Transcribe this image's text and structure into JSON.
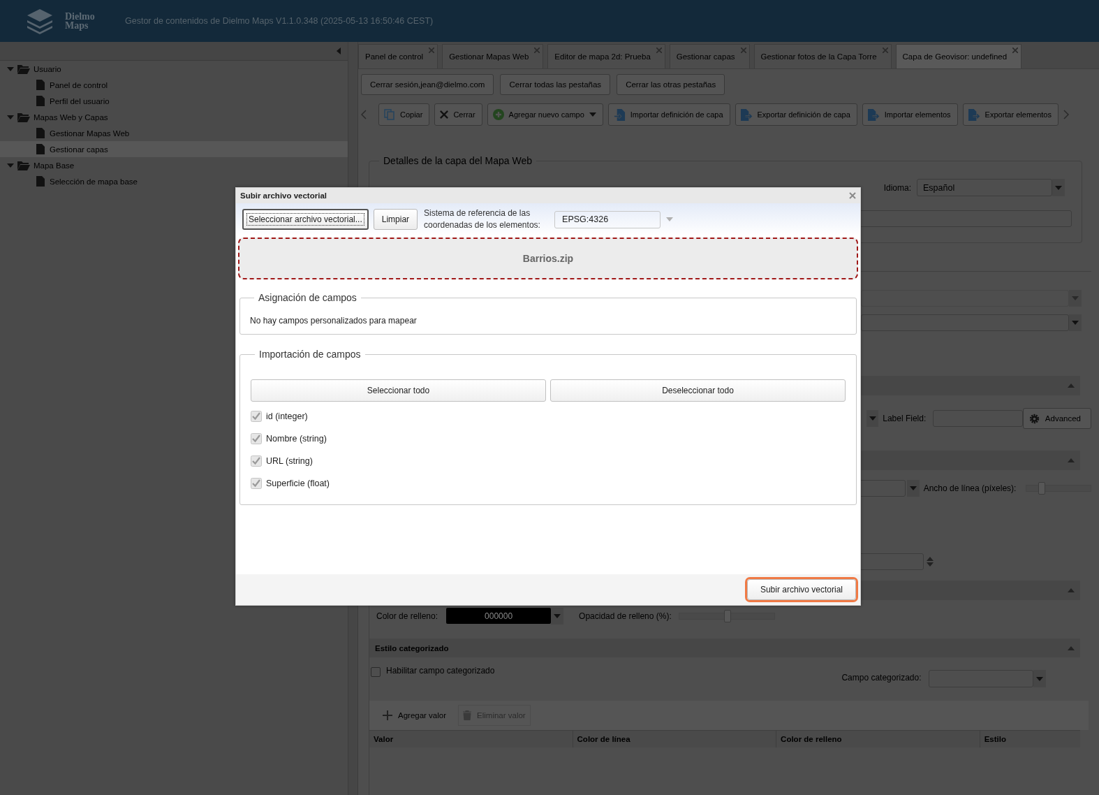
{
  "header": {
    "logo": [
      "Dielmo",
      "Maps"
    ],
    "title": "Gestor de contenidos de Dielmo Maps V1.1.0.348 (2025-05-13 16:50:46 CEST)"
  },
  "sidebar": {
    "tree": [
      {
        "label": "Usuario",
        "expanded": true,
        "children": [
          {
            "label": "Panel de control",
            "selected": false
          },
          {
            "label": "Perfil del usuario",
            "selected": false
          }
        ]
      },
      {
        "label": "Mapas Web y Capas",
        "expanded": true,
        "children": [
          {
            "label": "Gestionar Mapas Web",
            "selected": false
          },
          {
            "label": "Gestionar capas",
            "selected": true
          }
        ]
      },
      {
        "label": "Mapa Base",
        "expanded": true,
        "children": [
          {
            "label": "Selección de mapa base",
            "selected": false
          }
        ]
      }
    ]
  },
  "tabs": [
    {
      "label": "Panel de control",
      "selected": false
    },
    {
      "label": "Gestionar Mapas Web",
      "selected": false
    },
    {
      "label": "Editor de mapa 2d: Prueba",
      "selected": false
    },
    {
      "label": "Gestionar capas",
      "selected": false
    },
    {
      "label": "Gestionar fotos de la Capa Torre",
      "selected": false
    },
    {
      "label": "Capa de Geovisor: undefined",
      "selected": true
    }
  ],
  "session_buttons": [
    "Cerrar sesión,jean@dielmo.com",
    "Cerrar todas las pestañas",
    "Cerrar las otras pestañas"
  ],
  "toolbar": [
    {
      "label": "Copiar",
      "kind": "copy"
    },
    {
      "label": "Cerrar",
      "kind": "close"
    },
    {
      "label": "Agregar nuevo campo",
      "kind": "add",
      "menu": true
    },
    {
      "label": "Importar definición de capa",
      "kind": "import"
    },
    {
      "label": "Exportar definición de capa",
      "kind": "export"
    },
    {
      "label": "Importar elementos",
      "kind": "export"
    },
    {
      "label": "Exportar elementos",
      "kind": "export"
    }
  ],
  "details": {
    "legend": "Detalles de la capa del Mapa Web",
    "language_label": "Idioma:",
    "language_value": "Español"
  },
  "style": {
    "label_field_label": "Label Field:",
    "advanced": "Advanced",
    "line_width": {
      "label": "Ancho de línea (píxeles):",
      "level": 0.22
    },
    "fill_color_label": "Color de relleno:",
    "fill_color_value": "000000",
    "fill_opacity": {
      "label": "Opacidad de relleno (%):",
      "level": 0.5
    }
  },
  "categorized": {
    "title": "Estilo categorizado",
    "enable_label": "Habilitar campo categorizado",
    "enabled": false,
    "field_label": "Campo categorizado:",
    "add": "Agregar valor",
    "remove": "Eliminar valor",
    "remove_disabled": true,
    "columns": [
      "Valor",
      "Color de línea",
      "Color de relleno",
      "Estilo"
    ]
  },
  "modal": {
    "title": "Subir archivo vectorial",
    "select_button": "Seleccionar archivo vectorial...",
    "clear_button": "Limpiar",
    "crs_label": "Sistema de referencia de las coordenadas de los elementos:",
    "crs_value": "EPSG:4326",
    "file": "Barrios.zip",
    "mapping": {
      "legend": "Asignación de campos",
      "message": "No hay campos personalizados para mapear"
    },
    "import": {
      "legend": "Importación de campos",
      "select_all": "Seleccionar todo",
      "deselect_all": "Deseleccionar todo",
      "fields": [
        {
          "label": "id (integer)",
          "checked": true
        },
        {
          "label": "Nombre (string)",
          "checked": true
        },
        {
          "label": "URL (string)",
          "checked": true
        },
        {
          "label": "Superficie (float)",
          "checked": true
        }
      ]
    },
    "submit": "Subir archivo vectorial"
  }
}
